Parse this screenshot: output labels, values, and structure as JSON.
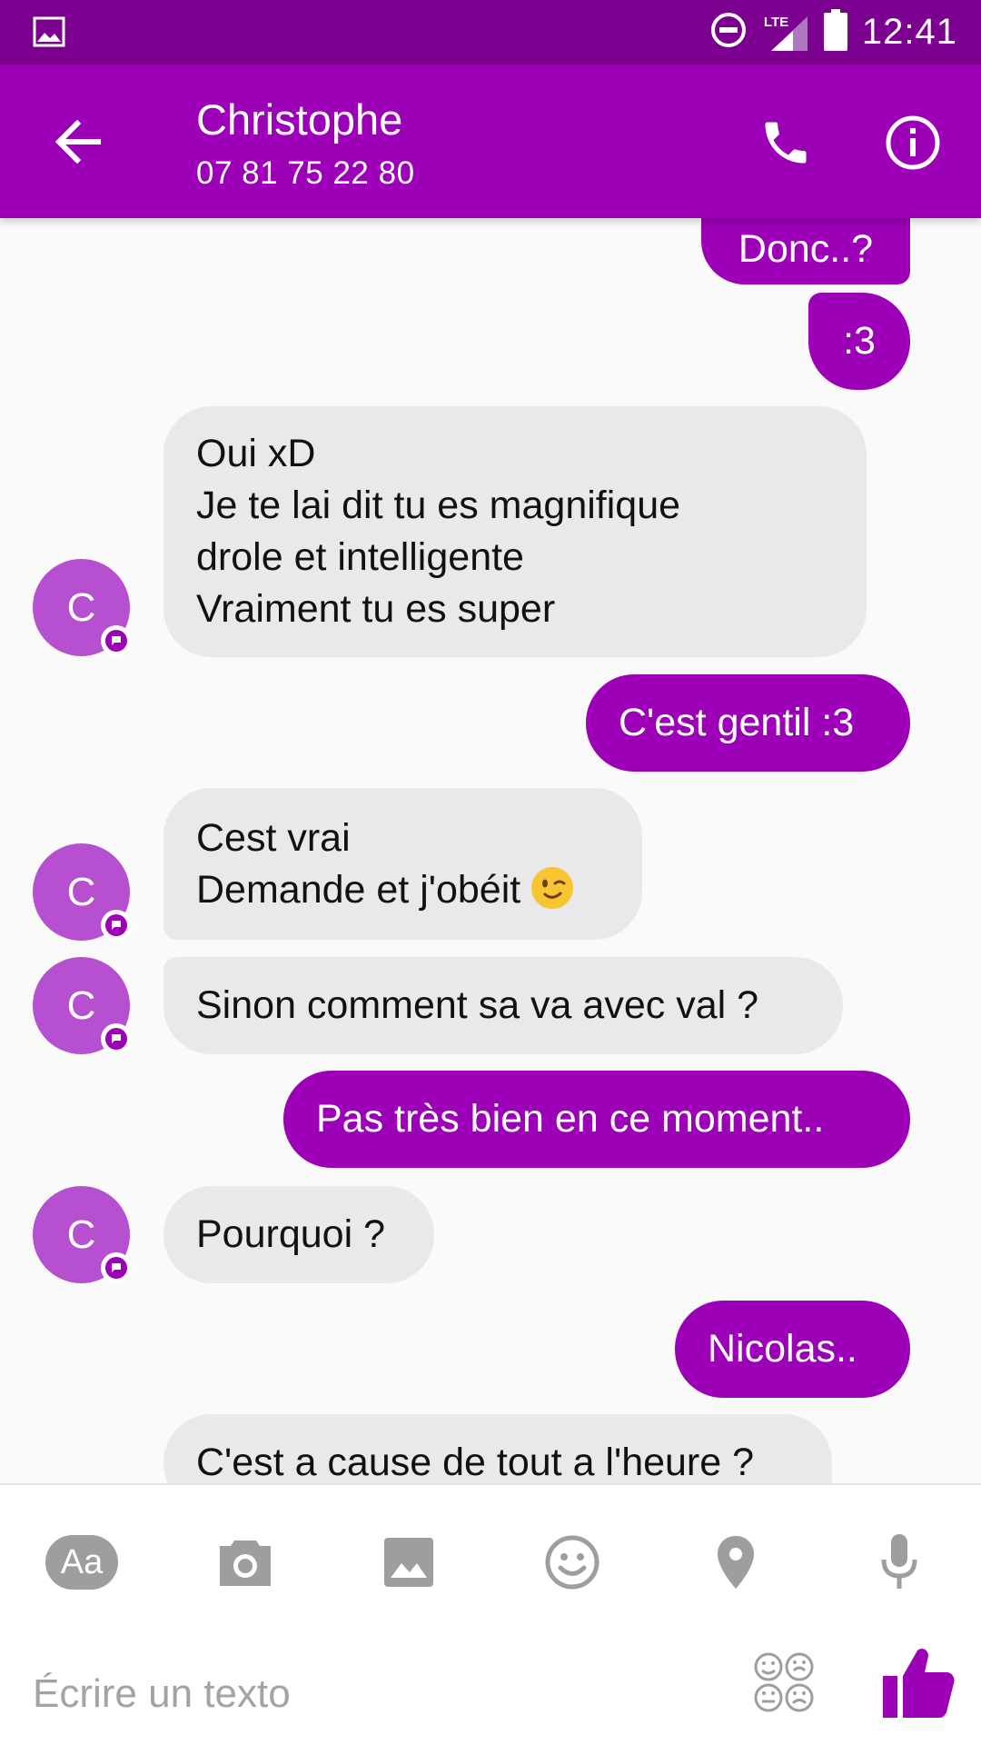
{
  "status_bar": {
    "network": "LTE",
    "time": "12:41"
  },
  "header": {
    "contact_name": "Christophe",
    "phone_number": "07 81 75 22 80",
    "icons": [
      "back-arrow-icon",
      "phone-icon",
      "info-icon"
    ]
  },
  "colors": {
    "accent": "#9c00b7",
    "status_bar": "#7b008f",
    "incoming_bubble": "#e9e9e9",
    "avatar": "#b64fd0"
  },
  "messages": [
    {
      "direction": "out",
      "lines": [
        "Donc..?"
      ]
    },
    {
      "direction": "out",
      "lines": [
        ":3"
      ]
    },
    {
      "direction": "in",
      "avatar": "C",
      "lines": [
        "Oui xD",
        "Je te lai dit tu es magnifique",
        "drole et intelligente",
        "Vraiment tu es super"
      ]
    },
    {
      "direction": "out",
      "lines": [
        "C'est gentil :3"
      ]
    },
    {
      "direction": "in",
      "avatar": "C",
      "lines": [
        "Cest vrai",
        "Demande et j'obéit"
      ],
      "emoji": "winking-face"
    },
    {
      "direction": "in",
      "avatar": "C",
      "lines": [
        "Sinon comment sa va avec val ?"
      ]
    },
    {
      "direction": "out",
      "lines": [
        "Pas très bien en ce moment.."
      ]
    },
    {
      "direction": "in",
      "avatar": "C",
      "lines": [
        "Pourquoi ?"
      ]
    },
    {
      "direction": "out",
      "lines": [
        "Nicolas.."
      ]
    },
    {
      "direction": "in",
      "lines": [
        "C'est a cause de tout a l'heure ?"
      ]
    }
  ],
  "composer": {
    "aa_label": "Aa",
    "placeholder": "Écrire un texto",
    "tools": [
      "text-format-icon",
      "camera-icon",
      "gallery-icon",
      "emoji-icon",
      "location-pin-icon",
      "microphone-icon"
    ]
  }
}
